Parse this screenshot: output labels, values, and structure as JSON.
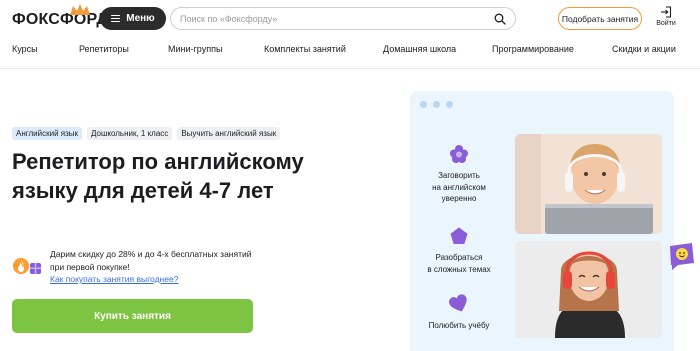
{
  "header": {
    "logo": "ФОКСФОРД",
    "menu_label": "Меню",
    "search_placeholder": "Поиск по «Фоксфорду»",
    "pick_classes": "Подобрать занятия",
    "login": "Войти"
  },
  "nav": [
    "Курсы",
    "Репетиторы",
    "Мини-группы",
    "Комплекты занятий",
    "Домашняя школа",
    "Программирование",
    "Скидки и акции"
  ],
  "hero": {
    "tags": [
      "Английский язык",
      "Дошкольник, 1 класс",
      "Выучить английский язык"
    ],
    "title_line1": "Репетитор по английскому",
    "title_line2": "языку для детей 4-7 лет",
    "promo_line1": "Дарим скидку до 28% и до 4-х бесплатных занятий",
    "promo_line2": "при первой покупке!",
    "promo_link": "Как покупать занятия выгоднее?",
    "buy_button": "Купить занятия"
  },
  "card": {
    "features": [
      {
        "line1": "Заговорить",
        "line2": "на английском",
        "line3": "уверенно",
        "icon": "flower-icon"
      },
      {
        "line1": "Разобраться",
        "line2": "в сложных темах",
        "line3": "",
        "icon": "pentagon-icon"
      },
      {
        "line1": "Полюбить учёбу",
        "line2": "",
        "line3": "",
        "icon": "heart-icon"
      }
    ]
  },
  "colors": {
    "accent_orange": "#f39b3b",
    "buy_green": "#7cc441",
    "card_bg": "#eaf5fd",
    "icon_purple": "#8a5cd8",
    "link_blue": "#3a6fe0"
  }
}
